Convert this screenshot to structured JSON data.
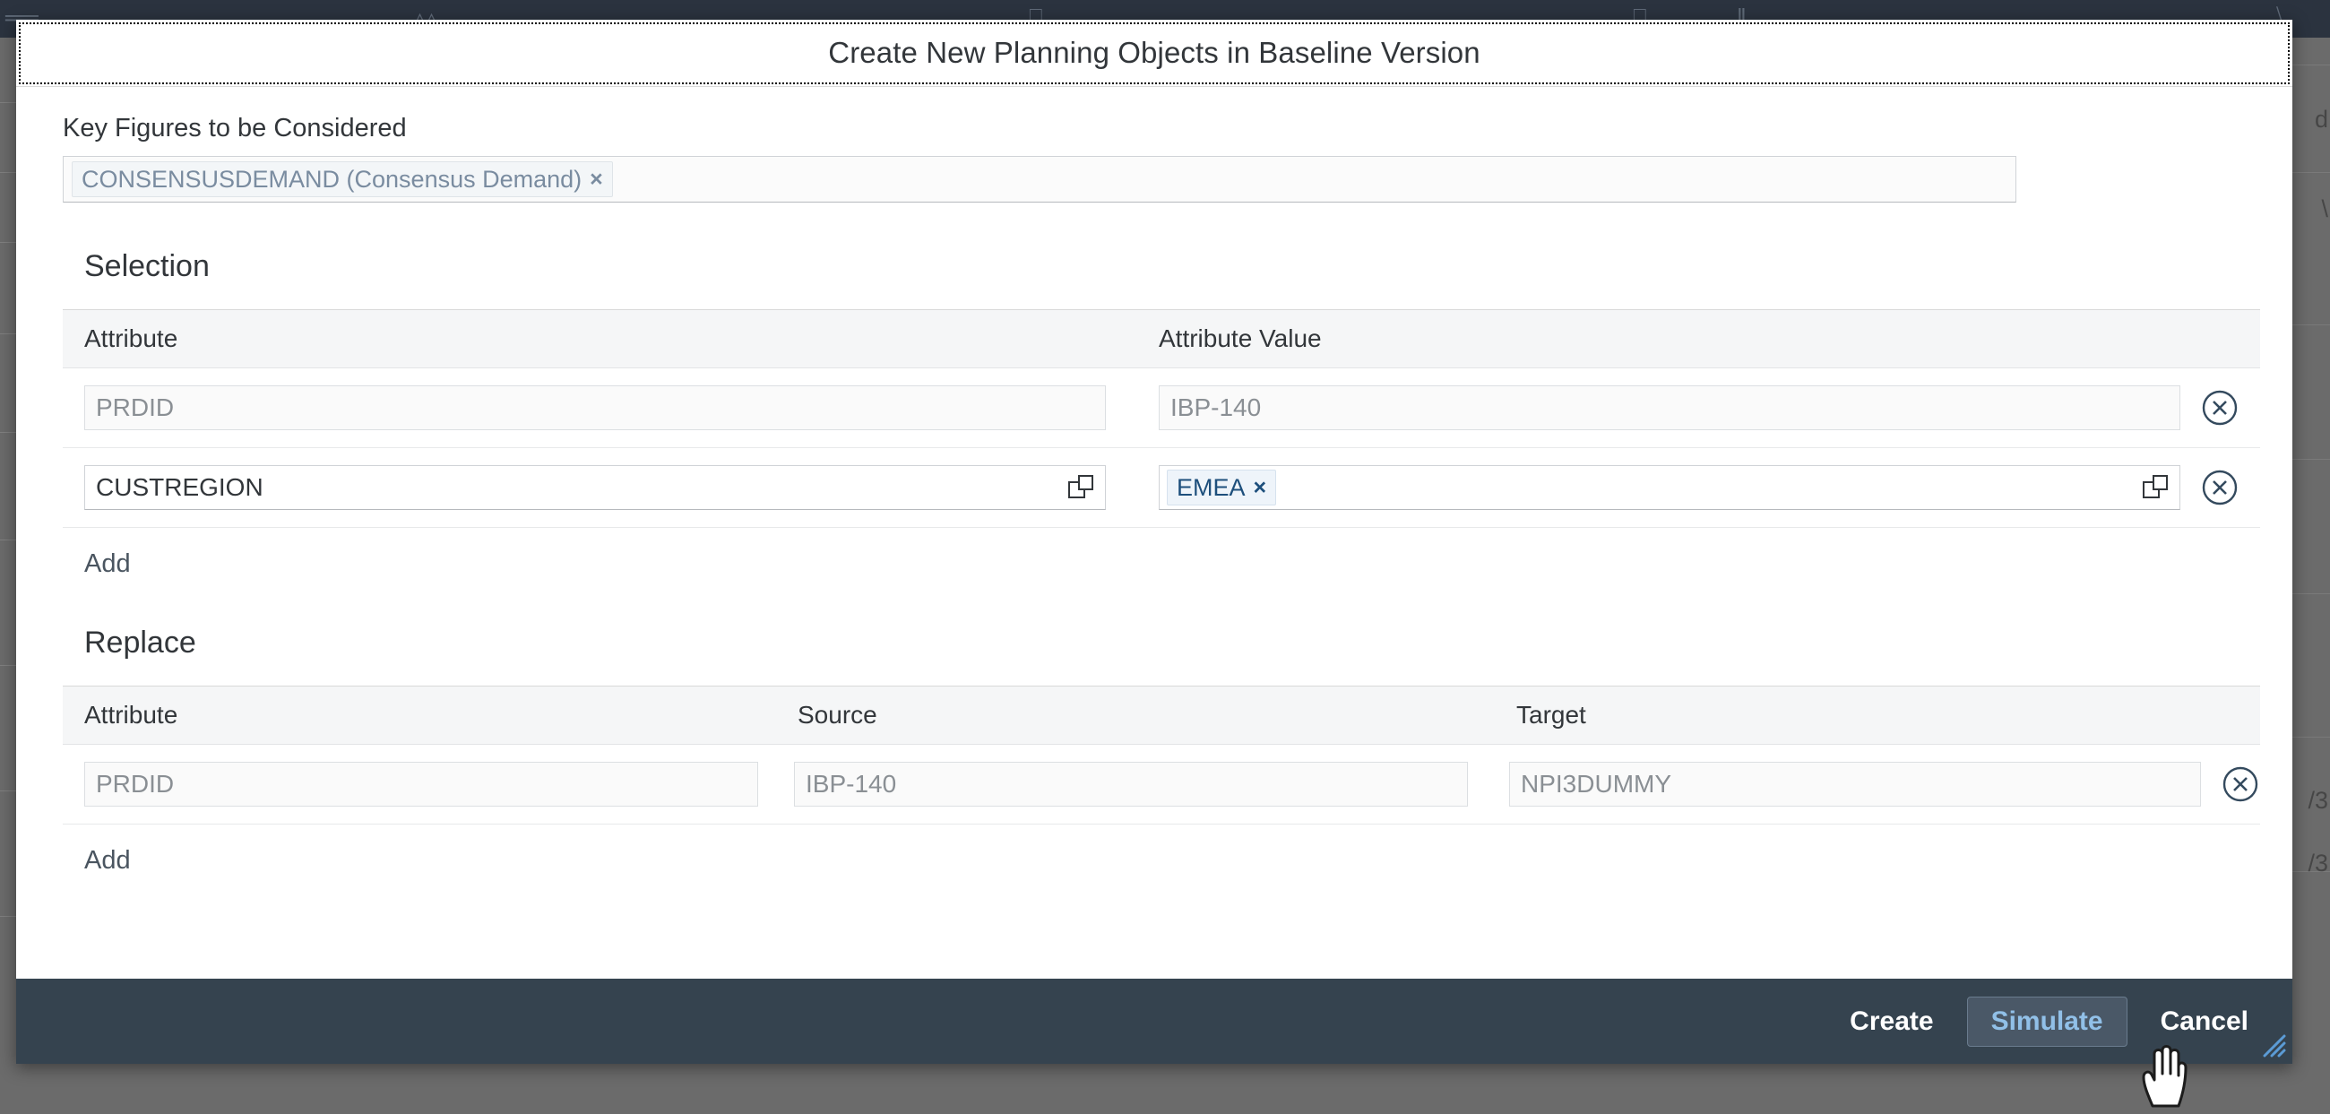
{
  "dialog": {
    "title": "Create New Planning Objects in Baseline Version"
  },
  "key_figures": {
    "label": "Key Figures to be Considered",
    "tokens": [
      {
        "text": "CONSENSUSDEMAND (Consensus Demand)",
        "remove": "×"
      }
    ]
  },
  "selection": {
    "title": "Selection",
    "columns": [
      "Attribute",
      "Attribute Value"
    ],
    "rows": [
      {
        "attribute": "PRDID",
        "attribute_readonly": true,
        "attribute_has_valuehelp": false,
        "value_text": "IBP-140",
        "value_readonly": true,
        "value_is_token": false,
        "value_has_valuehelp": false,
        "delete_icon": "decline-circle-icon"
      },
      {
        "attribute": "CUSTREGION",
        "attribute_readonly": false,
        "attribute_has_valuehelp": true,
        "value_text": "EMEA",
        "value_remove": "×",
        "value_readonly": false,
        "value_is_token": true,
        "value_has_valuehelp": true,
        "delete_icon": "decline-circle-icon"
      }
    ],
    "add_label": "Add"
  },
  "replace": {
    "title": "Replace",
    "columns": [
      "Attribute",
      "Source",
      "Target"
    ],
    "rows": [
      {
        "attribute": "PRDID",
        "source": "IBP-140",
        "target": "NPI3DUMMY",
        "readonly": true,
        "delete_icon": "decline-circle-icon"
      }
    ],
    "add_label": "Add"
  },
  "footer": {
    "buttons": [
      {
        "label": "Create",
        "state": "normal"
      },
      {
        "label": "Simulate",
        "state": "hovered"
      },
      {
        "label": "Cancel",
        "state": "normal"
      }
    ]
  },
  "colors": {
    "footer_bg": "#35434f",
    "dialog_bg": "#ffffff",
    "backdrop": "#6b6b6b",
    "topbar": "#2b333f",
    "accent_blue": "#91c0e8",
    "token_active_text": "#1d4f7c",
    "text_primary": "#32363a",
    "text_disabled": "#8a8f94"
  },
  "background": {
    "top_glyphs": [
      "║║║",
      "△△",
      "⎙",
      "⎙",
      "‖",
      "╲╲"
    ],
    "right_text": [
      "d",
      "\\",
      "/3",
      "/3"
    ]
  }
}
